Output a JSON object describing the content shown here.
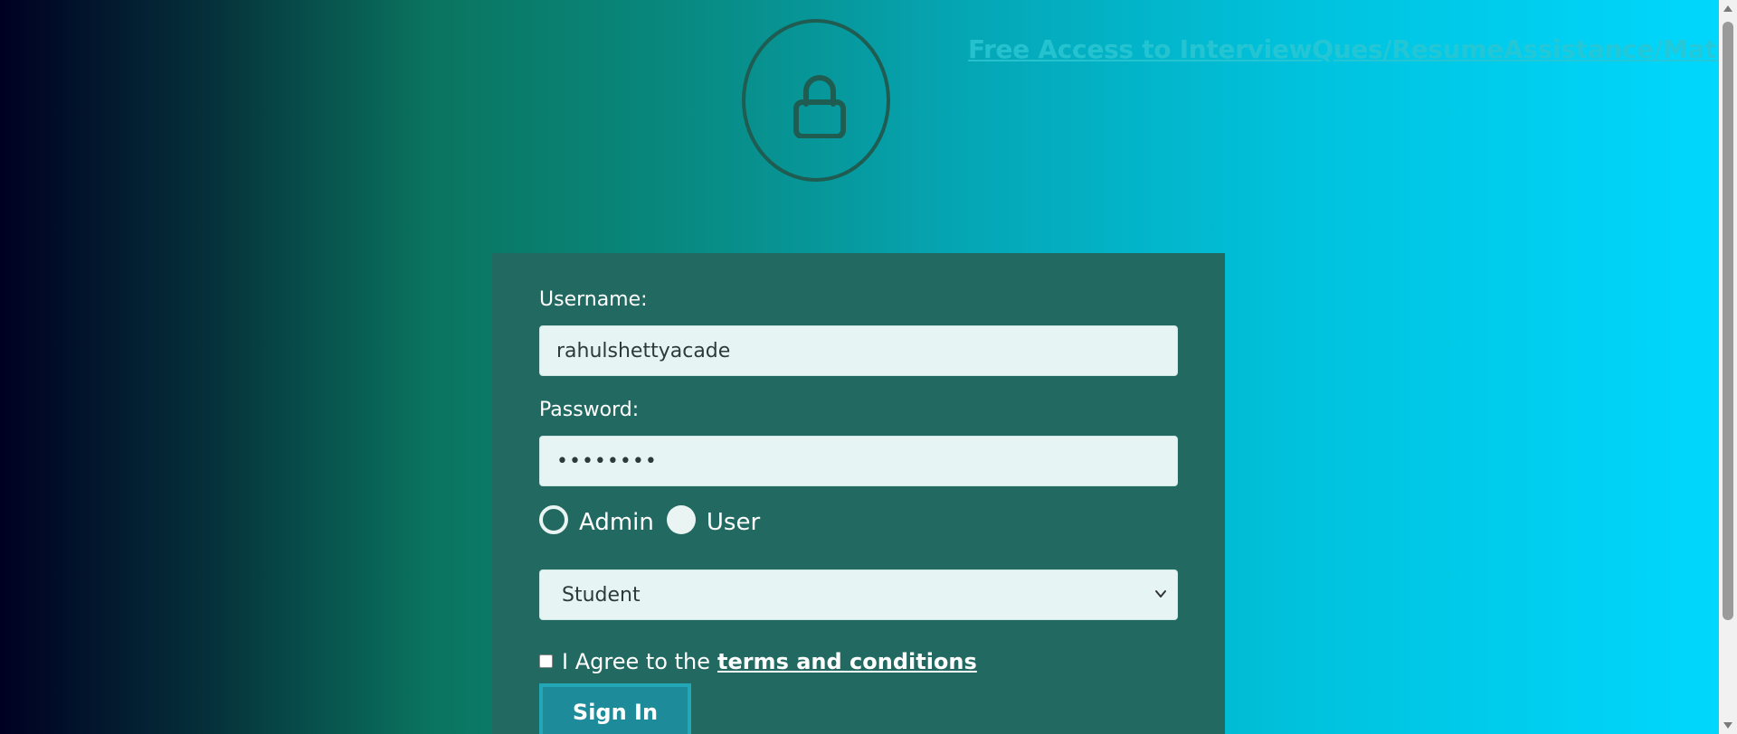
{
  "header": {
    "promo_link": "Free Access to InterviewQues/ResumeAssistance/Material",
    "lock_icon": "lock-icon"
  },
  "form": {
    "username_label": "Username:",
    "username_value": "rahulshettyacade",
    "password_label": "Password:",
    "password_value": "••••••••",
    "role_options": [
      {
        "label": "Admin",
        "selected": true
      },
      {
        "label": "User",
        "selected": false
      }
    ],
    "dropdown": {
      "selected": "Student",
      "icon": "chevron-down-icon"
    },
    "terms": {
      "checked": false,
      "prefix": "I Agree to the",
      "link_text": "terms and conditions"
    },
    "submit_label": "Sign In"
  },
  "colors": {
    "panel": "#226a61",
    "input_bg": "#e6f5f3",
    "button": "#1d8b99",
    "gradient_start": "#000022",
    "gradient_end": "#00d8ff"
  }
}
